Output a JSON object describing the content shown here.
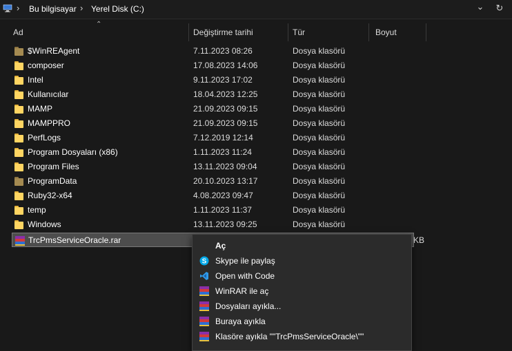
{
  "address_bar": {
    "crumbs": [
      "Bu bilgisayar",
      "Yerel Disk (C:)"
    ],
    "separator": "›",
    "dropdown_glyph": "⌄",
    "refresh_glyph": "↻",
    "location_icon": "computer-icon"
  },
  "columns": {
    "name": "Ad",
    "modified": "Değiştirme tarihi",
    "type": "Tür",
    "size": "Boyut",
    "sort_caret": "⌃"
  },
  "files": [
    {
      "name": "$WinREAgent",
      "date": "7.11.2023 08:26",
      "type": "Dosya klasörü",
      "icon": "folder-system"
    },
    {
      "name": "composer",
      "date": "17.08.2023 14:06",
      "type": "Dosya klasörü",
      "icon": "folder"
    },
    {
      "name": "Intel",
      "date": "9.11.2023 17:02",
      "type": "Dosya klasörü",
      "icon": "folder"
    },
    {
      "name": "Kullanıcılar",
      "date": "18.04.2023 12:25",
      "type": "Dosya klasörü",
      "icon": "folder"
    },
    {
      "name": "MAMP",
      "date": "21.09.2023 09:15",
      "type": "Dosya klasörü",
      "icon": "folder"
    },
    {
      "name": "MAMPPRO",
      "date": "21.09.2023 09:15",
      "type": "Dosya klasörü",
      "icon": "folder"
    },
    {
      "name": "PerfLogs",
      "date": "7.12.2019 12:14",
      "type": "Dosya klasörü",
      "icon": "folder"
    },
    {
      "name": "Program Dosyaları (x86)",
      "date": "1.11.2023 11:24",
      "type": "Dosya klasörü",
      "icon": "folder"
    },
    {
      "name": "Program Files",
      "date": "13.11.2023 09:04",
      "type": "Dosya klasörü",
      "icon": "folder"
    },
    {
      "name": "ProgramData",
      "date": "20.10.2023 13:17",
      "type": "Dosya klasörü",
      "icon": "folder-system"
    },
    {
      "name": "Ruby32-x64",
      "date": "4.08.2023 09:47",
      "type": "Dosya klasörü",
      "icon": "folder"
    },
    {
      "name": "temp",
      "date": "1.11.2023 11:37",
      "type": "Dosya klasörü",
      "icon": "folder"
    },
    {
      "name": "Windows",
      "date": "13.11.2023 09:25",
      "type": "Dosya klasörü",
      "icon": "folder"
    }
  ],
  "selected_file": {
    "name": "TrcPmsServiceOracle.rar",
    "size_fragment": "KB",
    "icon": "winrar-archive"
  },
  "context_menu": [
    {
      "label": "Aç",
      "icon": "none",
      "bold": true
    },
    {
      "label": "Skype ile paylaş",
      "icon": "skype-icon"
    },
    {
      "label": "Open with Code",
      "icon": "vscode-icon"
    },
    {
      "label": "WinRAR ile aç",
      "icon": "winrar-icon"
    },
    {
      "label": "Dosyaları ayıkla...",
      "icon": "winrar-icon"
    },
    {
      "label": "Buraya ayıkla",
      "icon": "winrar-icon"
    },
    {
      "label": "Klasöre ayıkla \"\"TrcPmsServiceOracle\\\"\"",
      "icon": "winrar-icon"
    }
  ],
  "colors": {
    "background": "#191919",
    "selection": "#4d4d4d",
    "folder": "#ffd562",
    "menu_bg": "#2b2b2b"
  }
}
